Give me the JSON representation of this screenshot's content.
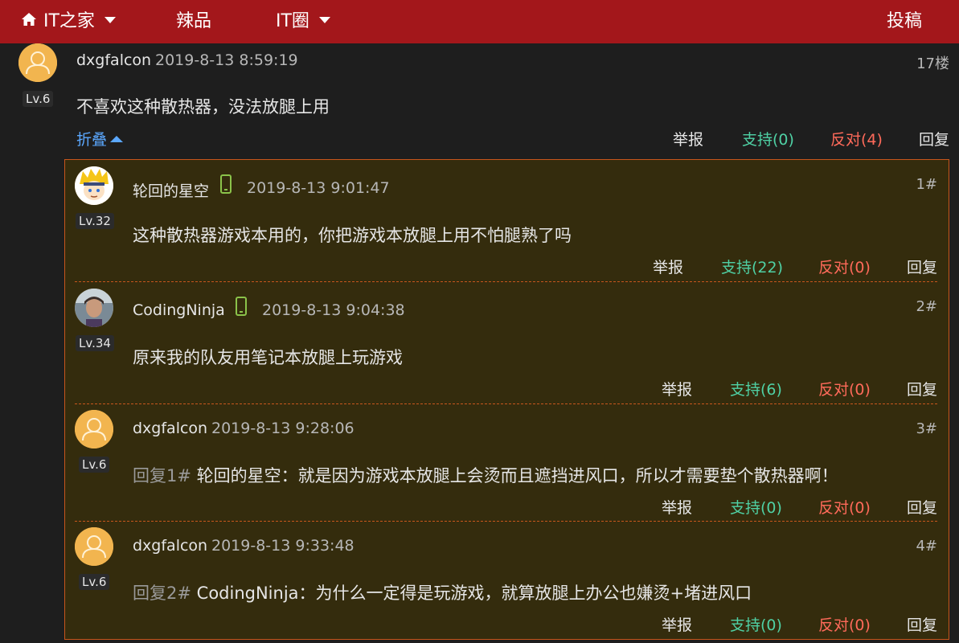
{
  "nav": {
    "home_label": "IT之家",
    "spicy_label": "辣品",
    "circle_label": "IT圈",
    "submit_label": "投稿",
    "brand_color": "#a3171b"
  },
  "comment": {
    "username": "dxgfalcon",
    "time": "2019-8-13 8:59:19",
    "floor": "17楼",
    "level": "Lv.6",
    "content": "不喜欢这种散热器，没法放腿上用",
    "collapse_label": "折叠",
    "report_label": "举报",
    "support_label": "支持(0)",
    "oppose_label": "反对(4)",
    "reply_label": "回复"
  },
  "replies": [
    {
      "username": "轮回的星空",
      "device": "phone-icon",
      "time": "2019-8-13 9:01:47",
      "floor": "1#",
      "level": "Lv.32",
      "reply_prefix": "",
      "content": "这种散热器游戏本用的，你把游戏本放腿上用不怕腿熟了吗",
      "report_label": "举报",
      "support_label": "支持(22)",
      "oppose_label": "反对(0)",
      "reply_label": "回复"
    },
    {
      "username": "CodingNinja",
      "device": "phone-icon",
      "time": "2019-8-13 9:04:38",
      "floor": "2#",
      "level": "Lv.34",
      "reply_prefix": "",
      "content": "原来我的队友用笔记本放腿上玩游戏",
      "report_label": "举报",
      "support_label": "支持(6)",
      "oppose_label": "反对(0)",
      "reply_label": "回复"
    },
    {
      "username": "dxgfalcon",
      "time": "2019-8-13 9:28:06",
      "floor": "3#",
      "level": "Lv.6",
      "reply_prefix": "回复1#",
      "content": "轮回的星空：就是因为游戏本放腿上会烫而且遮挡进风口，所以才需要垫个散热器啊！",
      "report_label": "举报",
      "support_label": "支持(0)",
      "oppose_label": "反对(0)",
      "reply_label": "回复"
    },
    {
      "username": "dxgfalcon",
      "time": "2019-8-13 9:33:48",
      "floor": "4#",
      "level": "Lv.6",
      "reply_prefix": "回复2#",
      "content": "CodingNinja：为什么一定得是玩游戏，就算放腿上办公也嫌烫+堵进风口",
      "report_label": "举报",
      "support_label": "支持(0)",
      "oppose_label": "反对(0)",
      "reply_label": "回复"
    }
  ]
}
